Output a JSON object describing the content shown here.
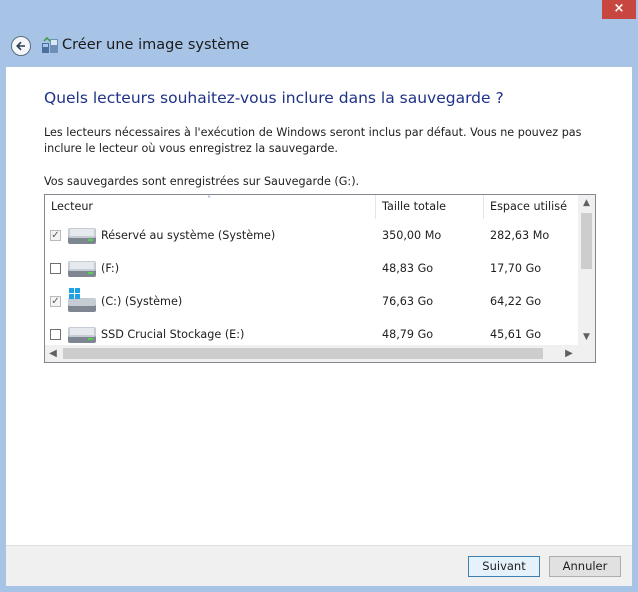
{
  "window": {
    "title": "Créer une image système",
    "close_glyph": "×",
    "back_icon": "back-arrow-icon",
    "app_icon": "system-image-backup-icon"
  },
  "main": {
    "heading": "Quels lecteurs souhaitez-vous inclure dans la sauvegarde ?",
    "description": "Les lecteurs nécessaires à l'exécution de Windows seront inclus par défaut. Vous ne pouvez pas inclure le lecteur où vous enregistrez la sauvegarde.",
    "saved_location": "Vos sauvegardes sont enregistrées sur Sauvegarde (G:)."
  },
  "drives_table": {
    "columns": [
      "Lecteur",
      "Taille totale",
      "Espace utilisé"
    ],
    "sort_indicator": "˄",
    "rows": [
      {
        "name": "Réservé au système (Système)",
        "size": "350,00 Mo",
        "used": "282,63 Mo",
        "checked": true,
        "disabled": true,
        "icon": "hard-drive-icon"
      },
      {
        "name": "(F:)",
        "size": "48,83 Go",
        "used": "17,70 Go",
        "checked": false,
        "disabled": false,
        "icon": "hard-drive-icon"
      },
      {
        "name": "(C:) (Système)",
        "size": "76,63 Go",
        "used": "64,22 Go",
        "checked": true,
        "disabled": true,
        "icon": "windows-drive-icon"
      },
      {
        "name": "SSD Crucial Stockage (E:)",
        "size": "48,79 Go",
        "used": "45,61 Go",
        "checked": false,
        "disabled": false,
        "icon": "hard-drive-icon"
      }
    ]
  },
  "buttons": {
    "next": "Suivant",
    "cancel": "Annuler"
  },
  "colors": {
    "frame": "#a7c4e6",
    "heading": "#1e3287",
    "close": "#c74740"
  }
}
